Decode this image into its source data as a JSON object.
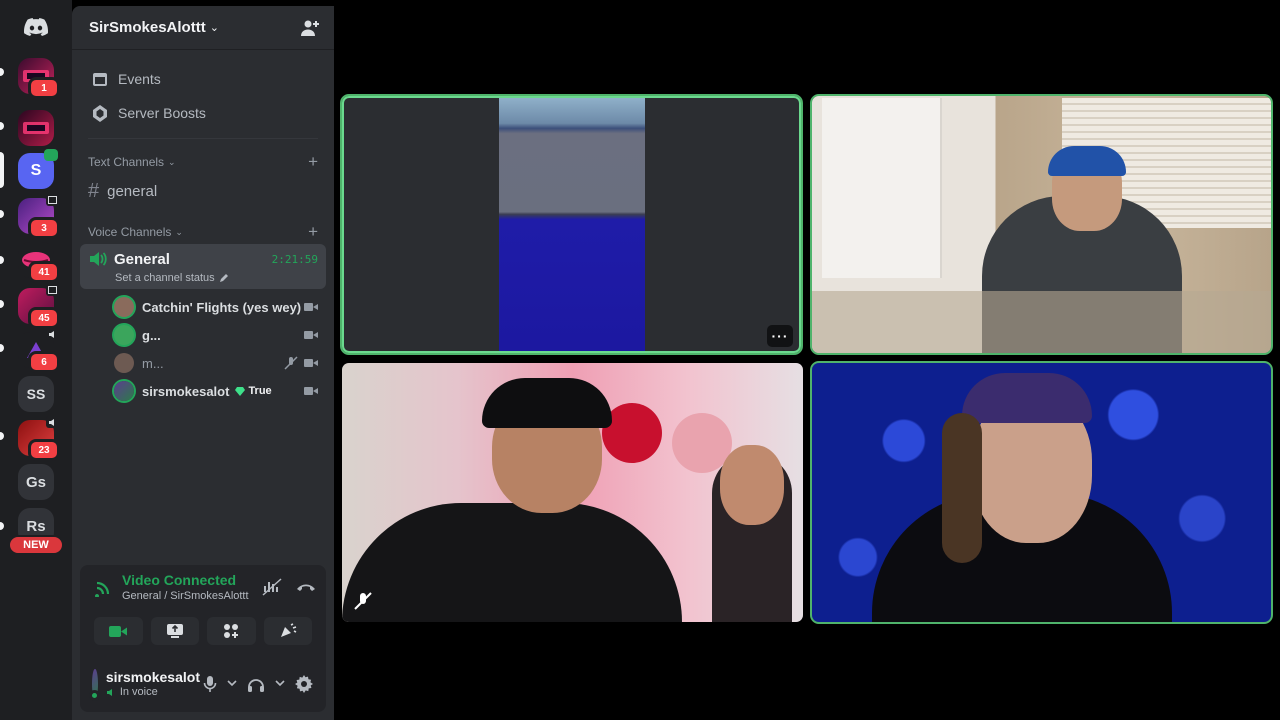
{
  "server": {
    "name": "SirSmokesAlottt",
    "menu": [
      {
        "label": "Events",
        "icon": "calendar-icon"
      },
      {
        "label": "Server Boosts",
        "icon": "boost-icon"
      }
    ]
  },
  "rail": {
    "servers": [
      {
        "label": "",
        "badge": "1",
        "icon": "server-neon-icon"
      },
      {
        "label": "",
        "badge": "",
        "icon": "server-neon-icon"
      },
      {
        "label": "S",
        "badge": "",
        "icon": "server-s-icon"
      },
      {
        "label": "",
        "badge": "3",
        "icon": "server-purple-icon"
      },
      {
        "label": "",
        "badge": "41",
        "icon": "server-lips-icon"
      },
      {
        "label": "",
        "badge": "45",
        "icon": "server-text-art-icon"
      },
      {
        "label": "",
        "badge": "6",
        "icon": "server-purple-logo-icon"
      },
      {
        "label": "SS",
        "badge": "",
        "icon": "server-ss-icon"
      },
      {
        "label": "",
        "badge": "23",
        "icon": "server-red-icon"
      },
      {
        "label": "Gs",
        "badge": "",
        "icon": "server-gs-icon"
      },
      {
        "label": "Rs",
        "badge": "",
        "icon": "server-rs-icon"
      }
    ],
    "new_label": "NEW"
  },
  "categories": {
    "text": "Text Channels",
    "voice": "Voice Channels"
  },
  "text_channels": [
    {
      "name": "general"
    }
  ],
  "voice_channel": {
    "name": "General",
    "timer": "2:21:59",
    "status_placeholder": "Set a channel status"
  },
  "members": [
    {
      "name": "Catchin' Flights (yes wey)",
      "speaking": true,
      "dim": false,
      "tag": "",
      "deafened": false
    },
    {
      "name": "g...",
      "speaking": true,
      "dim": false,
      "tag": "",
      "deafened": false
    },
    {
      "name": "m...",
      "speaking": false,
      "dim": true,
      "tag": "",
      "deafened": true
    },
    {
      "name": "sirsmokesalot",
      "speaking": true,
      "dim": false,
      "tag": "True",
      "deafened": false
    }
  ],
  "rtc": {
    "title": "Video Connected",
    "location": "General / SirSmokesAlottt"
  },
  "user": {
    "name": "sirsmokesalot",
    "status": "In voice"
  },
  "colors": {
    "green": "#23a55a",
    "red": "#f23f43",
    "blurple": "#5865f2",
    "speaking_border": "#4fb36b"
  }
}
